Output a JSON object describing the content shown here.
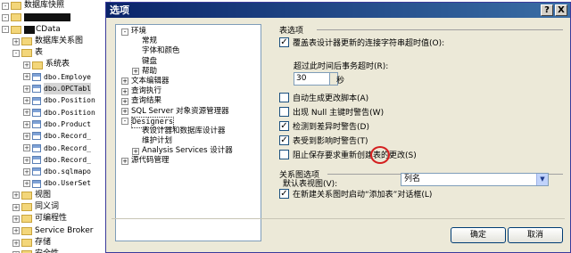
{
  "object_explorer": {
    "rows": [
      {
        "indent": 0,
        "expander": "-",
        "icon": "folder",
        "text": "数据库快照"
      },
      {
        "indent": 0,
        "expander": "-",
        "icon": "db",
        "text": ""
      },
      {
        "indent": 0,
        "expander": "-",
        "icon": "db",
        "text": "CData"
      },
      {
        "indent": 1,
        "expander": "+",
        "icon": "folder",
        "text": "数据库关系图"
      },
      {
        "indent": 1,
        "expander": "-",
        "icon": "folder",
        "text": "表"
      },
      {
        "indent": 2,
        "expander": "+",
        "icon": "folder",
        "text": "系统表"
      },
      {
        "indent": 2,
        "expander": "+",
        "icon": "table",
        "text": "dbo.Employe"
      },
      {
        "indent": 2,
        "expander": "+",
        "icon": "table",
        "text": "dbo.OPCTabl",
        "selected": true
      },
      {
        "indent": 2,
        "expander": "+",
        "icon": "table",
        "text": "dbo.Position"
      },
      {
        "indent": 2,
        "expander": "+",
        "icon": "table",
        "text": "dbo.Position"
      },
      {
        "indent": 2,
        "expander": "+",
        "icon": "table",
        "text": "dbo.Product"
      },
      {
        "indent": 2,
        "expander": "+",
        "icon": "table",
        "text": "dbo.Record_"
      },
      {
        "indent": 2,
        "expander": "+",
        "icon": "table",
        "text": "dbo.Record_"
      },
      {
        "indent": 2,
        "expander": "+",
        "icon": "table",
        "text": "dbo.Record_"
      },
      {
        "indent": 2,
        "expander": "+",
        "icon": "table",
        "text": "dbo.sqlmapo"
      },
      {
        "indent": 2,
        "expander": "+",
        "icon": "table",
        "text": "dbo.UserSet"
      },
      {
        "indent": 1,
        "expander": "+",
        "icon": "folder",
        "text": "视图"
      },
      {
        "indent": 1,
        "expander": "+",
        "icon": "folder",
        "text": "同义词"
      },
      {
        "indent": 1,
        "expander": "+",
        "icon": "folder",
        "text": "可编程性"
      },
      {
        "indent": 1,
        "expander": "+",
        "icon": "folder",
        "text": "Service Broker"
      },
      {
        "indent": 1,
        "expander": "+",
        "icon": "folder",
        "text": "存储"
      },
      {
        "indent": 1,
        "expander": "+",
        "icon": "folder",
        "text": "安全性"
      }
    ]
  },
  "dialog": {
    "title": "选项",
    "help_btn": "?",
    "close_btn": "X",
    "tree": [
      {
        "indent": 0,
        "expander": "-",
        "text": "环境"
      },
      {
        "indent": 1,
        "expander": "",
        "text": "常规"
      },
      {
        "indent": 1,
        "expander": "",
        "text": "字体和颜色"
      },
      {
        "indent": 1,
        "expander": "",
        "text": "键盘"
      },
      {
        "indent": 1,
        "expander": "+",
        "text": "帮助"
      },
      {
        "indent": 0,
        "expander": "+",
        "text": "文本编辑器"
      },
      {
        "indent": 0,
        "expander": "+",
        "text": "查询执行"
      },
      {
        "indent": 0,
        "expander": "+",
        "text": "查询结果"
      },
      {
        "indent": 0,
        "expander": "+",
        "text": "SQL Server 对象资源管理器"
      },
      {
        "indent": 0,
        "expander": "-",
        "text": "Designers",
        "selected": true
      },
      {
        "indent": 1,
        "expander": "",
        "text": "表设计器和数据库设计器"
      },
      {
        "indent": 1,
        "expander": "",
        "text": "维护计划"
      },
      {
        "indent": 1,
        "expander": "+",
        "text": "Analysis Services 设计器"
      },
      {
        "indent": 0,
        "expander": "+",
        "text": "源代码管理"
      }
    ],
    "table_options": {
      "header": "表选项",
      "override_checkbox": {
        "label": "覆盖表设计器更新的连接字符串超时值(O):",
        "checked": true
      },
      "timeout_label": "超过此时间后事务超时(R):",
      "timeout_value": "30",
      "timeout_unit": "秒",
      "checkboxes": [
        {
          "label": "自动生成更改脚本(A)",
          "checked": false
        },
        {
          "label": "出现 Null 主键时警告(W)",
          "checked": false
        },
        {
          "label": "检测到差异时警告(D)",
          "checked": true
        },
        {
          "label": "表受到影响时警告(T)",
          "checked": true
        },
        {
          "label": "阻止保存要求重新创建表的更改(S)",
          "checked": false
        }
      ]
    },
    "diagram_options": {
      "header": "关系图选项",
      "default_view_label": "默认表视图(V):",
      "default_view_value": "列名",
      "launch_checkbox": {
        "label": "在新建关系图时启动“添加表”对话框(L)",
        "checked": true
      }
    },
    "ok_label": "确定",
    "cancel_label": "取消"
  }
}
